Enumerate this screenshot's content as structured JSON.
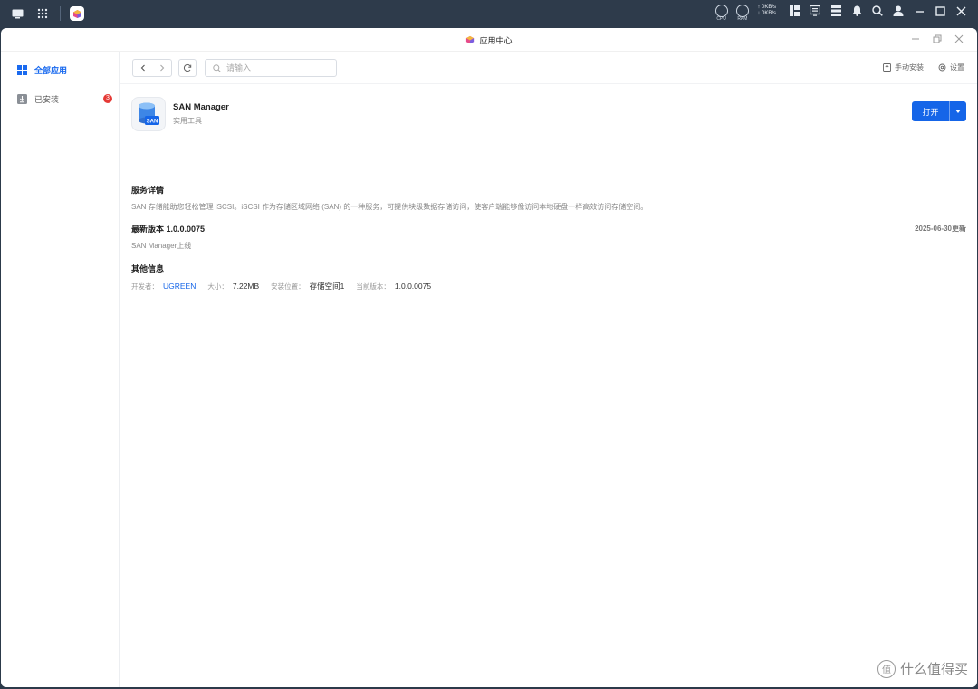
{
  "window": {
    "title": "应用中心"
  },
  "os_tray": {
    "net_up": "↑ 0KB/s",
    "net_down": "↓ 0KB/s",
    "cpu_label": "CPU",
    "ram_label": "RAM"
  },
  "sidebar": {
    "items": [
      {
        "label": "全部应用",
        "icon": "grid-icon"
      },
      {
        "label": "已安装",
        "icon": "download-icon",
        "badge": "3"
      }
    ]
  },
  "toolbar": {
    "search_placeholder": "请输入",
    "manual_install": "手动安装",
    "settings": "设置"
  },
  "app": {
    "name": "SAN Manager",
    "category": "实用工具",
    "icon_text": "SAN",
    "open_label": "打开"
  },
  "details": {
    "title": "服务详情",
    "text": "SAN 存储能助您轻松管理 iSCSI。iSCSI 作为存储区域网络 (SAN) 的一种服务，可提供块级数据存储访问，使客户端能够像访问本地硬盘一样高效访问存储空间。"
  },
  "version": {
    "title": "最新版本 1.0.0.0075",
    "date": "2025-06-30更新",
    "notes": "SAN Manager上线"
  },
  "other": {
    "title": "其他信息",
    "developer_label": "开发者：",
    "developer": "UGREEN",
    "size_label": "大小：",
    "size": "7.22MB",
    "location_label": "安装位置：",
    "location": "存储空间1",
    "current_label": "当前版本：",
    "current": "1.0.0.0075"
  },
  "watermark": {
    "text": "什么值得买",
    "glyph": "值"
  },
  "colors": {
    "accent": "#1565e8",
    "badge": "#e53935",
    "os_bar": "#2e3b4b"
  }
}
